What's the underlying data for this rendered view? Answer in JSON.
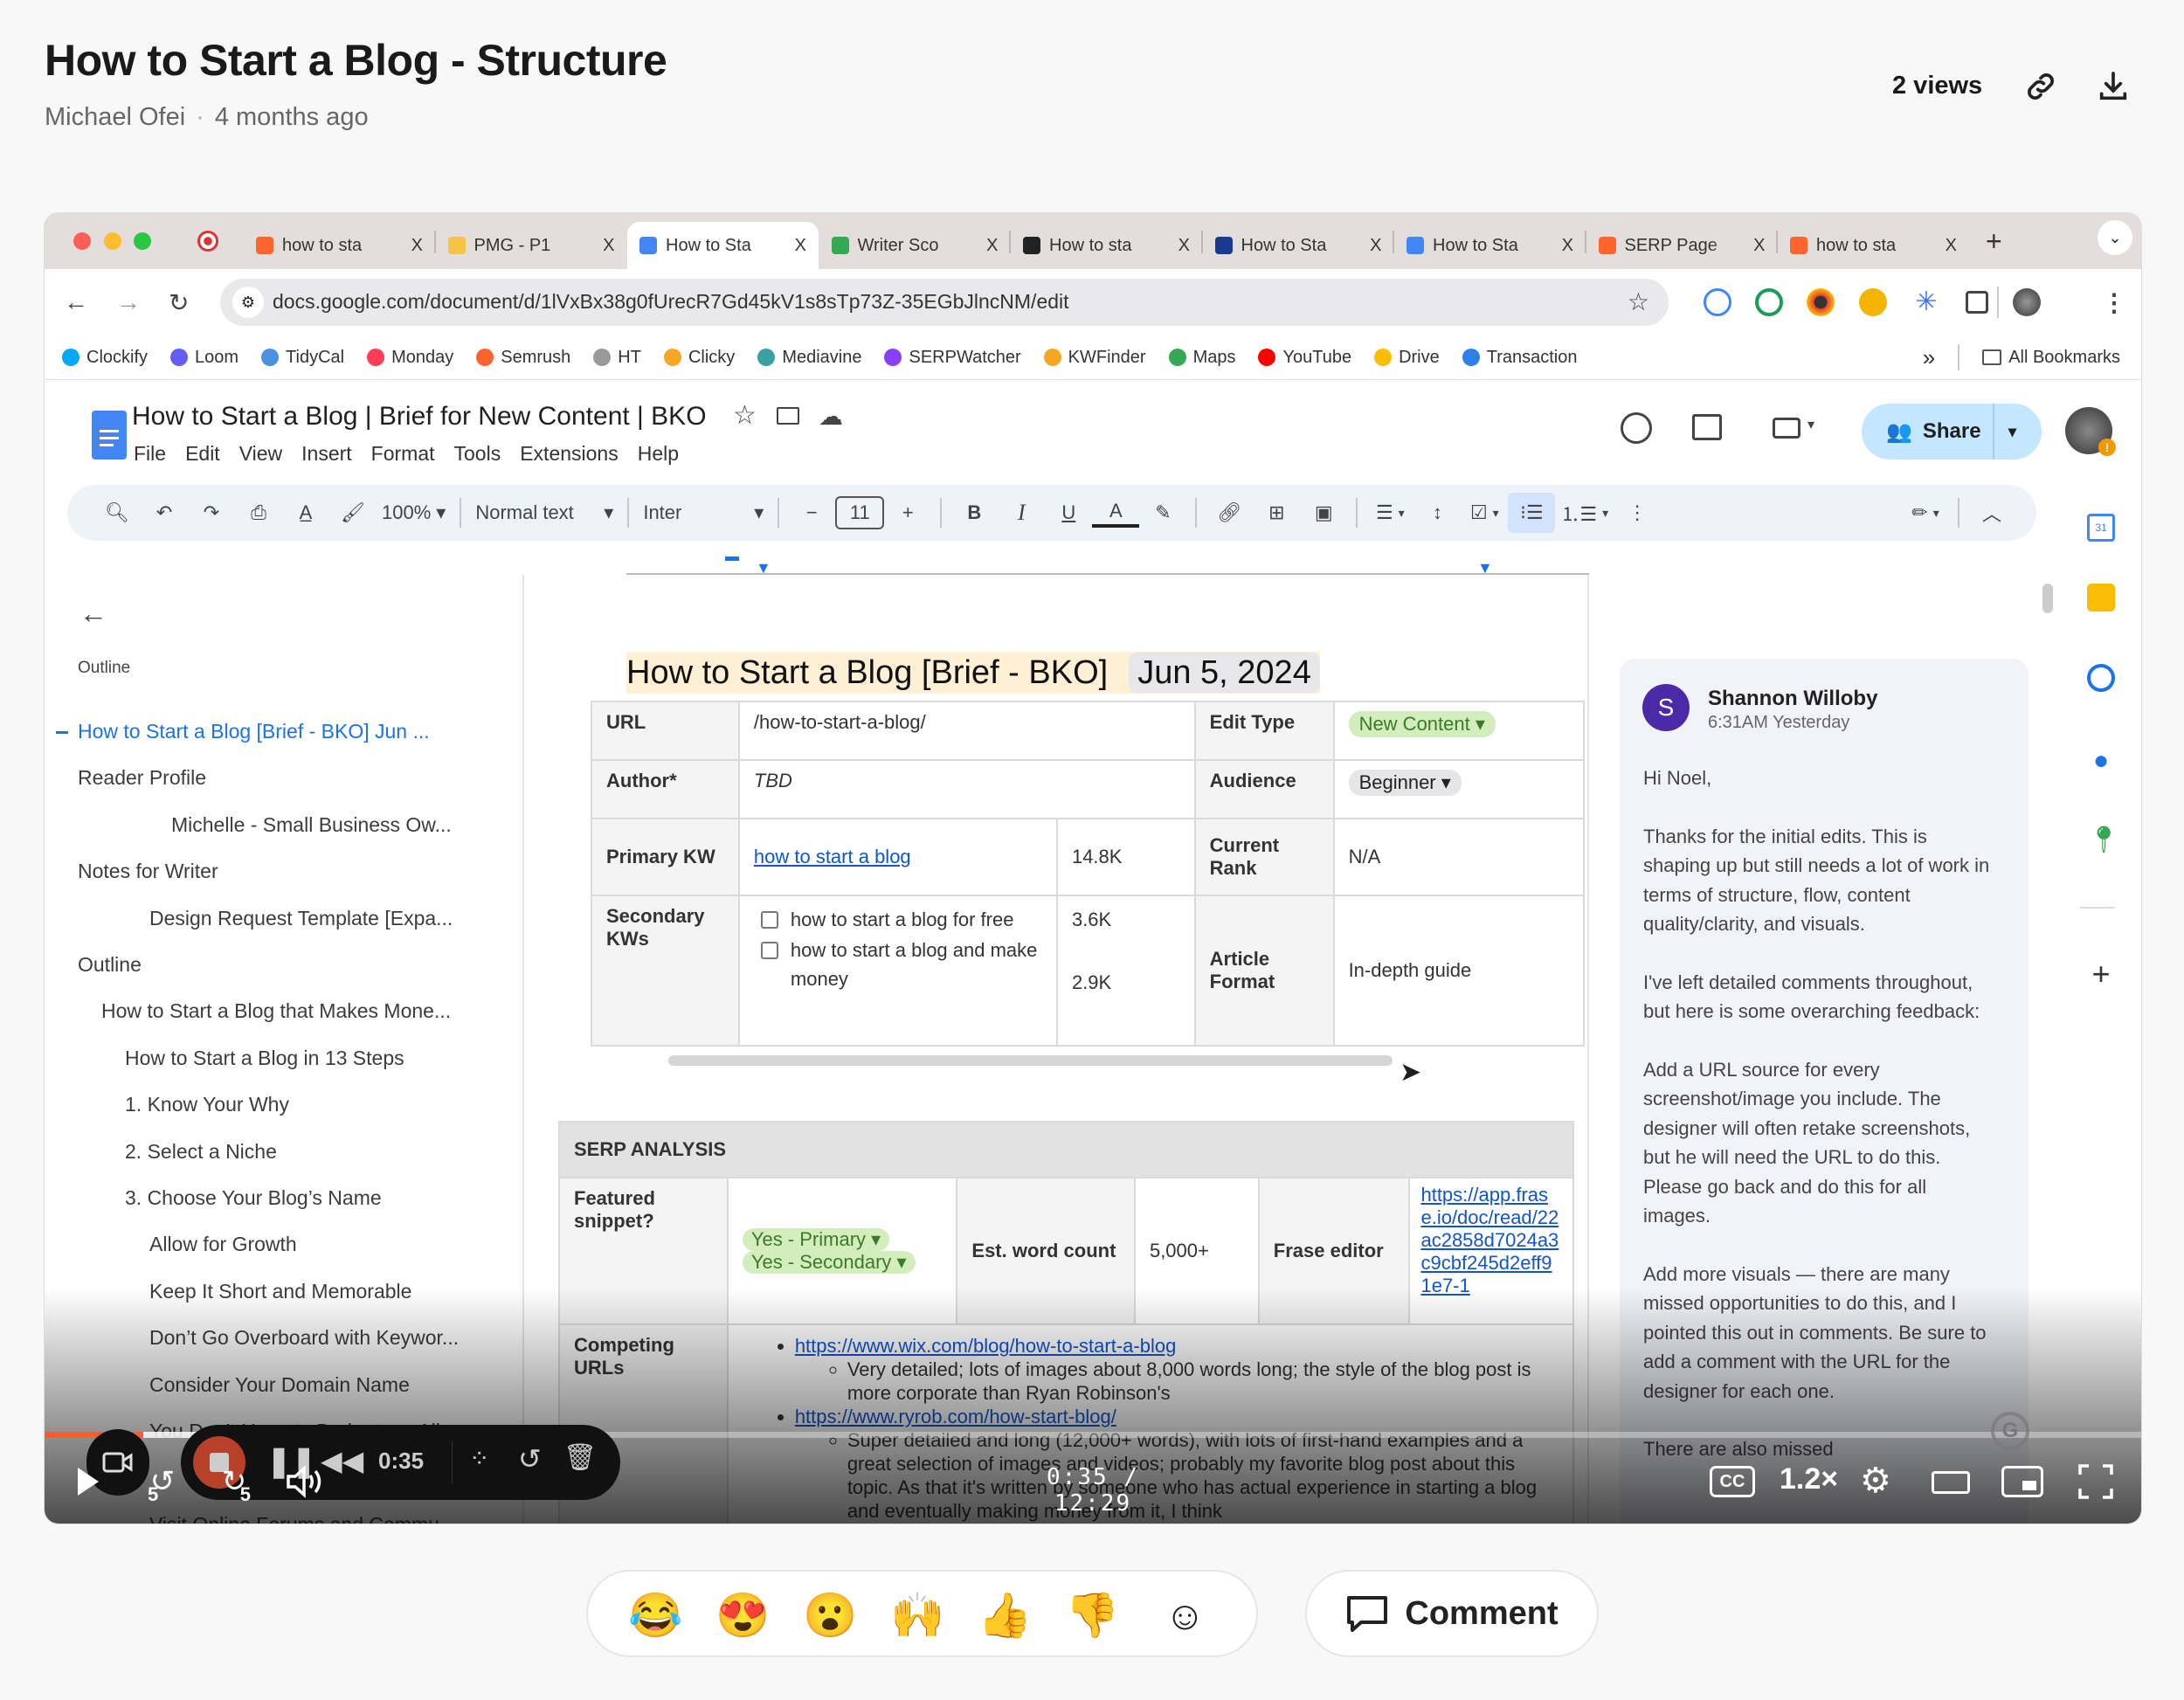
{
  "video": {
    "title": "How to Start a Blog - Structure",
    "author": "Michael Ofei",
    "age": "4 months ago",
    "views": "2 views",
    "icons": [
      "link-icon",
      "download-icon"
    ]
  },
  "browser": {
    "tabs": [
      {
        "title": "how to sta",
        "favicon_color": "#ff642d"
      },
      {
        "title": "PMG - P1",
        "favicon_color": "#f6c343"
      },
      {
        "title": "How to Sta",
        "favicon_color": "#4285f4",
        "active": true
      },
      {
        "title": "Writer Sco",
        "favicon_color": "#34a853"
      },
      {
        "title": "How to sta",
        "favicon_color": "#222222"
      },
      {
        "title": "How to Sta",
        "favicon_color": "#1a3a8f"
      },
      {
        "title": "How to Sta",
        "favicon_color": "#4285f4"
      },
      {
        "title": "SERP Page",
        "favicon_color": "#ff642d"
      },
      {
        "title": "how to sta",
        "favicon_color": "#ff642d"
      }
    ],
    "tab_close": "X",
    "new_tab": "+",
    "url": "docs.google.com/document/d/1lVxBx38g0fUrecR7Gd45kV1s8sTp73Z-35EGbJlncNM/edit",
    "bookmarks": [
      {
        "label": "Clockify",
        "color": "#03a9f4"
      },
      {
        "label": "Loom",
        "color": "#625df5"
      },
      {
        "label": "TidyCal",
        "color": "#4a90e2"
      },
      {
        "label": "Monday",
        "color": "#ff3d57"
      },
      {
        "label": "Semrush",
        "color": "#ff642d"
      },
      {
        "label": "HT",
        "color": "#999999"
      },
      {
        "label": "Clicky",
        "color": "#f5a623"
      },
      {
        "label": "Mediavine",
        "color": "#3aa0a0"
      },
      {
        "label": "SERPWatcher",
        "color": "#8a3ffc"
      },
      {
        "label": "KWFinder",
        "color": "#f5a623"
      },
      {
        "label": "Maps",
        "color": "#34a853"
      },
      {
        "label": "YouTube",
        "color": "#ff0000"
      },
      {
        "label": "Drive",
        "color": "#fbbc04"
      },
      {
        "label": "Transaction",
        "color": "#2f80ed"
      }
    ],
    "more_bookmarks": "»",
    "all_bookmarks": "All Bookmarks"
  },
  "docs": {
    "title": "How to Start a Blog | Brief for New Content | BKO",
    "menu": [
      "File",
      "Edit",
      "View",
      "Insert",
      "Format",
      "Tools",
      "Extensions",
      "Help"
    ],
    "share": "Share",
    "toolbar": {
      "zoom": "100%",
      "style": "Normal text",
      "font": "Inter",
      "font_size": "11"
    },
    "outline_label": "Outline",
    "outline": [
      {
        "text": "How to Start a Blog [Brief - BKO] Jun ...",
        "level": 0,
        "active": true
      },
      {
        "text": "Reader Profile",
        "level": 0
      },
      {
        "text": "Michelle - Small Business Ow...",
        "level": 4
      },
      {
        "text": "Notes for Writer",
        "level": 0
      },
      {
        "text": "Design Request Template [Expa...",
        "level": 3
      },
      {
        "text": "Outline",
        "level": 0
      },
      {
        "text": "How to Start a Blog that Makes Mone...",
        "level": 1
      },
      {
        "text": "How to Start a Blog in 13 Steps",
        "level": 2
      },
      {
        "text": "1. Know Your Why",
        "level": 2
      },
      {
        "text": "2. Select a Niche",
        "level": 2
      },
      {
        "text": "3. Choose Your Blog’s Name",
        "level": 2
      },
      {
        "text": "Allow for Growth",
        "level": 3
      },
      {
        "text": "Keep It Short and Memorable",
        "level": 3
      },
      {
        "text": "Don’t Go Overboard with Keywor...",
        "level": 3
      },
      {
        "text": "Consider Your Domain Name",
        "level": 3
      },
      {
        "text": "You Don’t Have to Brainstorm All",
        "level": 3
      },
      {
        "text": "",
        "level": 3
      },
      {
        "text": "Visit Online Forums and Commu...",
        "level": 3
      }
    ],
    "heading": "How to Start a Blog [Brief - BKO]",
    "heading_date": "Jun 5, 2024",
    "brief": {
      "url_label": "URL",
      "url": "/how-to-start-a-blog/",
      "edit_type_label": "Edit Type",
      "edit_type": "New Content",
      "author_label": "Author*",
      "author": "TBD",
      "audience_label": "Audience",
      "audience": "Beginner",
      "primary_kw_label": "Primary KW",
      "primary_kw": "how to start a blog",
      "primary_kw_volume": "14.8K",
      "current_rank_label": "Current Rank",
      "current_rank": "N/A",
      "secondary_kw_label": "Secondary KWs",
      "secondary_kws": [
        {
          "kw": "how to start a blog for free",
          "volume": "3.6K"
        },
        {
          "kw": "how to start a blog and make money",
          "volume": "2.9K"
        }
      ],
      "article_format_label": "Article Format",
      "article_format": "In-depth guide"
    },
    "serp": {
      "header": "SERP ANALYSIS",
      "featured_label": "Featured snippet?",
      "featured_values": [
        "Yes - Primary",
        "Yes - Secondary"
      ],
      "word_count_label": "Est. word count",
      "word_count": "5,000+",
      "frase_label": "Frase editor",
      "frase_link": "https://app.frase.io/doc/read/22ac2858d7024a3c9cbf245d2eff91e7-1",
      "competing_label": "Competing URLs",
      "competing": [
        {
          "url": "https://www.wix.com/blog/how-to-start-a-blog",
          "note": "Very detailed; lots of images about 8,000 words long; the style of the blog post is more corporate than Ryan Robinson's"
        },
        {
          "url": "https://www.ryrob.com/how-start-blog/",
          "note": "Super detailed and long (12,000+ words), with lots of first-hand examples and a great selection of images and videos; probably my favorite blog post about this topic. As that it's written by someone who has actual experience in starting a blog and eventually making money from it, I think"
        }
      ]
    },
    "comment": {
      "avatar_letter": "S",
      "author": "Shannon Willoby",
      "time": "6:31AM Yesterday",
      "paragraphs": [
        "Hi Noel,",
        "Thanks for the initial edits. This is shaping up but still needs a lot of work in terms of structure, flow, content quality/clarity, and visuals.",
        "I've left detailed comments throughout, but here is some overarching feedback:",
        "Add a URL source for every screenshot/image you include. The designer will often retake screenshots, but he will need the URL to do this. Please go back and do this for all images.",
        "Add more visuals — there are many missed opportunities to do this, and I pointed this out in comments. Be sure to add a comment with the URL for the designer for each one.",
        "There are also missed"
      ]
    }
  },
  "player": {
    "recording_time": "0:35",
    "current": "0:35",
    "separator": "/",
    "duration": "12:29",
    "played_fraction": 0.047,
    "buffered_fraction": 0.14,
    "skip_back": "5",
    "skip_forward": "5",
    "speed": "1.2×",
    "cc": "CC",
    "accent": "#ff5a36"
  },
  "reactions": [
    "😂",
    "😍",
    "😮",
    "🙌",
    "👍",
    "👎"
  ],
  "comment_button": "Comment"
}
